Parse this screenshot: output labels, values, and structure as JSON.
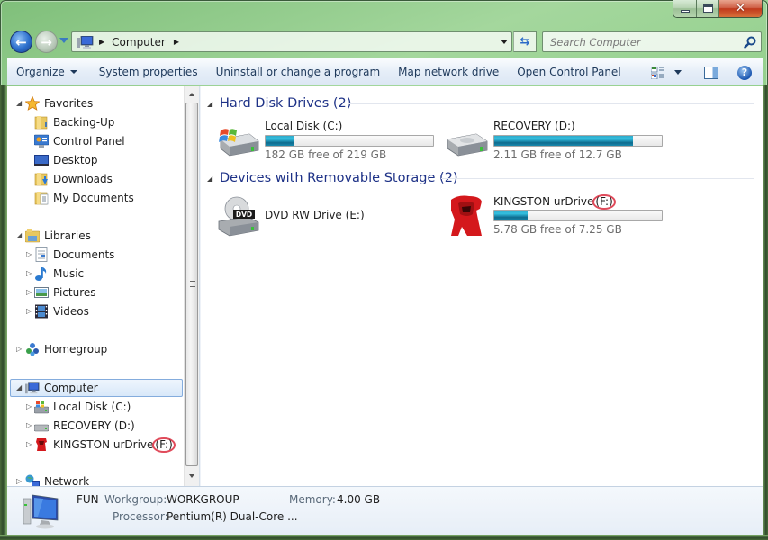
{
  "window": {
    "caption_buttons": {
      "minimize": "minimize",
      "maximize": "maximize",
      "close": "close"
    }
  },
  "address_bar": {
    "breadcrumbs": [
      "Computer"
    ],
    "icon": "computer-icon"
  },
  "search": {
    "placeholder": "Search Computer",
    "value": ""
  },
  "toolbar": {
    "organize_label": "Organize",
    "system_properties_label": "System properties",
    "uninstall_label": "Uninstall or change a program",
    "map_drive_label": "Map network drive",
    "control_panel_label": "Open Control Panel"
  },
  "nav_pane": {
    "favorites": {
      "label": "Favorites",
      "items": [
        {
          "label": "Backing-Up",
          "icon": "folder-icon"
        },
        {
          "label": "Control Panel",
          "icon": "control-panel-icon"
        },
        {
          "label": "Desktop",
          "icon": "desktop-icon"
        },
        {
          "label": "Downloads",
          "icon": "downloads-folder-icon"
        },
        {
          "label": "My Documents",
          "icon": "documents-folder-icon"
        }
      ]
    },
    "libraries": {
      "label": "Libraries",
      "items": [
        {
          "label": "Documents",
          "icon": "document-icon"
        },
        {
          "label": "Music",
          "icon": "music-note-icon"
        },
        {
          "label": "Pictures",
          "icon": "picture-icon"
        },
        {
          "label": "Videos",
          "icon": "film-icon"
        }
      ]
    },
    "homegroup": {
      "label": "Homegroup"
    },
    "computer": {
      "label": "Computer",
      "selected": true,
      "items": [
        {
          "label": "Local Disk (C:)",
          "icon": "windows-drive-icon"
        },
        {
          "label": "RECOVERY (D:)",
          "icon": "drive-icon"
        },
        {
          "label_main": "KINGSTON urDrive",
          "label_letter": "(F:)",
          "icon": "kingston-icon"
        }
      ]
    },
    "network": {
      "label": "Network"
    }
  },
  "content": {
    "groups": [
      {
        "title": "Hard Disk Drives (2)",
        "drives": [
          {
            "name": "Local Disk (C:)",
            "free_text": "182 GB free of 219 GB",
            "used_fraction": 0.17,
            "icon": "windows-drive-icon"
          },
          {
            "name": "RECOVERY (D:)",
            "free_text": "2.11 GB free of 12.7 GB",
            "used_fraction": 0.83,
            "icon": "drive-icon"
          }
        ]
      },
      {
        "title": "Devices with Removable Storage (2)",
        "drives": [
          {
            "name": "DVD RW Drive (E:)",
            "icon": "dvd-drive-icon"
          },
          {
            "name_main": "KINGSTON urDrive",
            "name_letter": "(F:)",
            "free_text": "5.78 GB free of 7.25 GB",
            "used_fraction": 0.2,
            "icon": "kingston-icon"
          }
        ]
      }
    ],
    "bar_color": "#1a8aae"
  },
  "details": {
    "computer_name": "FUN",
    "workgroup_label": "Workgroup:",
    "workgroup_value": "WORKGROUP",
    "memory_label": "Memory:",
    "memory_value": "4.00 GB",
    "processor_label": "Processor:",
    "processor_value": "Pentium(R) Dual-Core ..."
  },
  "colors": {
    "accent_blue_heading": "#1e3287",
    "toolbar_text": "#1e395b",
    "annotation_circle": "#e04a5a"
  }
}
